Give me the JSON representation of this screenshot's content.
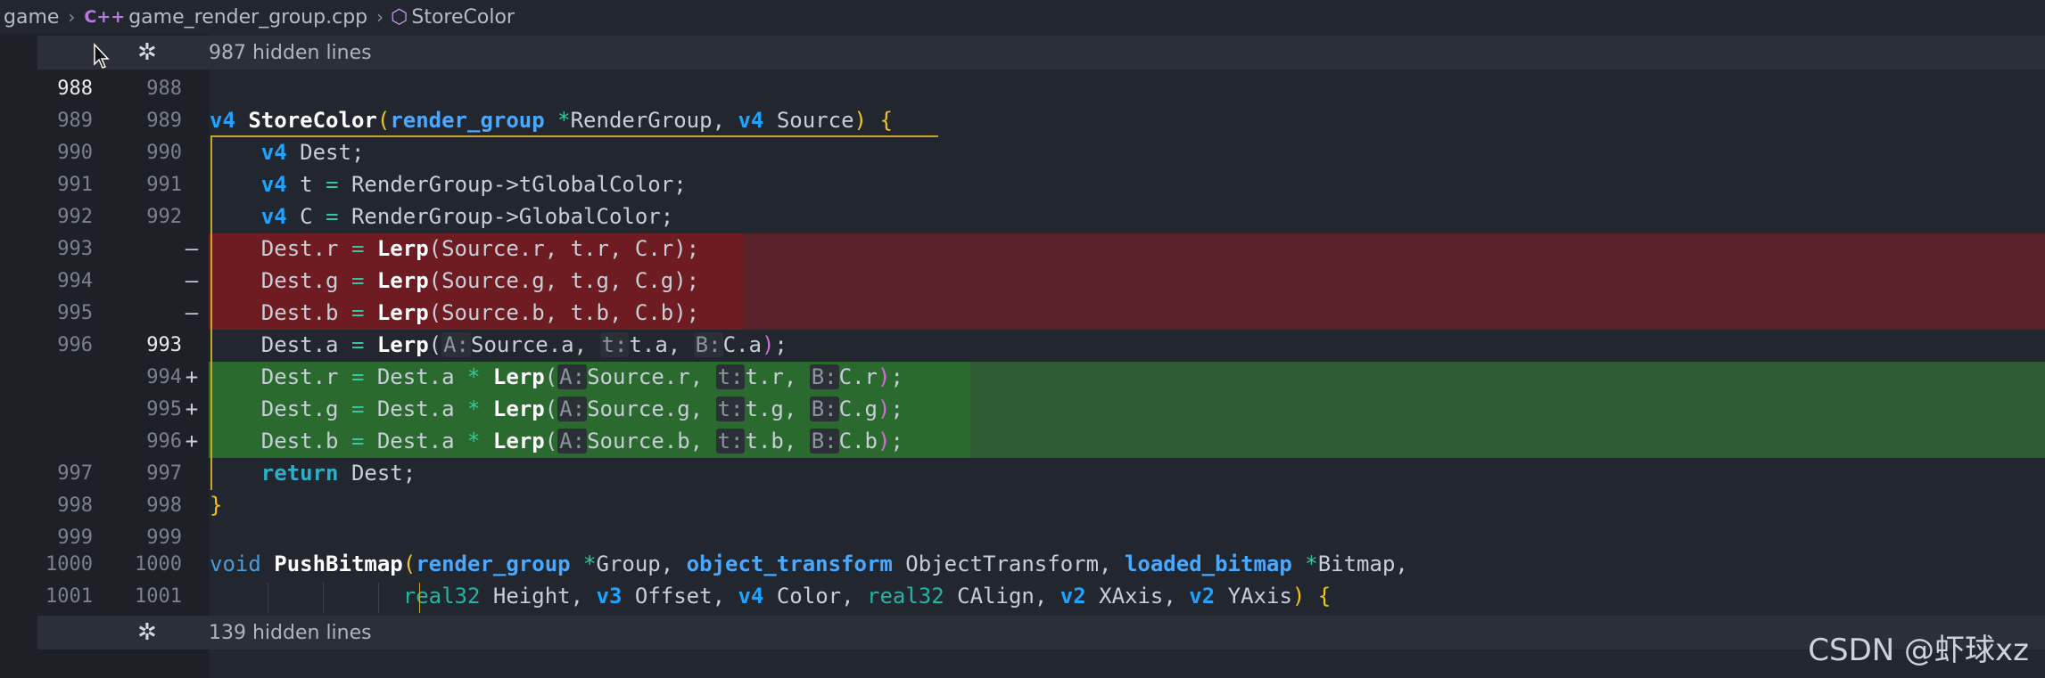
{
  "breadcrumb": {
    "folder": "game",
    "file": "game_render_group.cpp",
    "symbol": "StoreColor",
    "file_icon": "C++",
    "symbol_icon": "cube-icon"
  },
  "hidden_top": "987 hidden lines",
  "hidden_bottom": "139 hidden lines",
  "lines": [
    {
      "old": "988",
      "new": "988",
      "mark": ""
    },
    {
      "old": "989",
      "new": "989",
      "mark": ""
    },
    {
      "old": "990",
      "new": "990",
      "mark": ""
    },
    {
      "old": "991",
      "new": "991",
      "mark": ""
    },
    {
      "old": "992",
      "new": "992",
      "mark": ""
    },
    {
      "old": "993",
      "new": "",
      "mark": "—"
    },
    {
      "old": "994",
      "new": "",
      "mark": "—"
    },
    {
      "old": "995",
      "new": "",
      "mark": "—"
    },
    {
      "old": "996",
      "new": "993",
      "mark": ""
    },
    {
      "old": "",
      "new": "994",
      "mark": "+"
    },
    {
      "old": "",
      "new": "995",
      "mark": "+"
    },
    {
      "old": "",
      "new": "996",
      "mark": "+"
    },
    {
      "old": "997",
      "new": "997",
      "mark": ""
    },
    {
      "old": "998",
      "new": "998",
      "mark": ""
    },
    {
      "old": "999",
      "new": "999",
      "mark": ""
    },
    {
      "old": "1000",
      "new": "1000",
      "mark": ""
    },
    {
      "old": "1001",
      "new": "1001",
      "mark": ""
    }
  ],
  "tokens": {
    "v4": "v4",
    "StoreColor": "StoreColor",
    "render_group": "render_group",
    "star": "*",
    "RenderGroup": "RenderGroup",
    "Source": "Source",
    "Dest": "Dest",
    "t": "t",
    "C": "C",
    "eq": "=",
    "tGlobalColor": "RenderGroup->tGlobalColor;",
    "GlobalColor": "RenderGroup->GlobalColor;",
    "Lerp": "Lerp",
    "return": "return",
    "void": "void",
    "PushBitmap": "PushBitmap",
    "object_transform": "object_transform",
    "ObjectTransform": "ObjectTransform",
    "loaded_bitmap": "loaded_bitmap",
    "Bitmap": "Bitmap",
    "Group": "Group",
    "real32": "real32",
    "Height": "Height",
    "v3": "v3",
    "Offset": "Offset",
    "Color": "Color",
    "CAlign": "CAlign",
    "v2": "v2",
    "XAxis": "XAxis",
    "YAxis": "YAxis",
    "hintA": "A:",
    "hintt": "t:",
    "hintB": "B:"
  },
  "watermark": "CSDN @虾球xz",
  "colors": {
    "removed": "#5a232c",
    "added": "#2f5d33",
    "keyword": "#1fa3ff",
    "brace": "#f2c419"
  }
}
